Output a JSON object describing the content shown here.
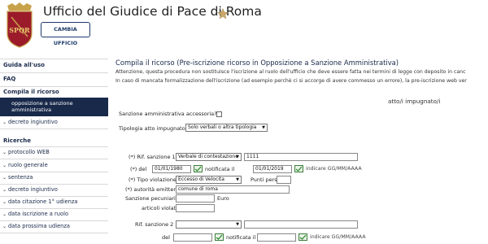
{
  "header": {
    "title": "Ufficio del Giudice di Pace di Roma",
    "logo_text": "SPQR",
    "change_office_label": "CAMBIA UFFICIO"
  },
  "sidebar": {
    "guida": "Guida all'uso",
    "faq": "FAQ",
    "compila": "Compila il ricorso",
    "active_item": "opposizione a sanzione amministrativa",
    "decreto": "decreto ingiuntivo",
    "ricerche": "Ricerche",
    "search_items": [
      "protocollo WEB",
      "ruolo generale",
      "sentenza",
      "decreto ingiuntivo",
      "data citazione 1° udienza",
      "data iscrizione a ruolo",
      "data prossima udienza"
    ]
  },
  "main": {
    "title": "Compila il ricorso (Pre-iscrizione ricorso in Opposizione a Sanzione Amministrativa)",
    "notice_line1": "Attenzione, questa procedura non sostituisce l'iscrizione al ruolo dell'ufficio che deve essere fatta nei termini di legge con deposito in canc",
    "notice_line2": "In caso di mancata formalizzazione dell'iscrizione (ad esempio perchè ci si accorge di avere commesso un errore), la pre-iscrizione web ver",
    "atto_impugnato": "atto/i impugnato/i",
    "sanzione_accessoria_label": "Sanzione amministrativa accessoria?",
    "tipologia_label": "Tipologia atto impugnato",
    "tipologia_value": "Solo verbali o altra tipologia",
    "rif_sanzione_1_label": "(*) Rif. sanzione 1",
    "rif_sanzione_1_type": "Verbale di contestazione",
    "rif_sanzione_1_number": "1111",
    "del_label_1": "(*) del",
    "del_value_1": "01/01/1980",
    "notificata_label_1": "notificata il",
    "notificata_value_1": "01/01/2019",
    "indicare_1": "indicare GG/MM/AAAA",
    "tipo_violazione_label": "(*) Tipo violazione",
    "tipo_violazione_value": "Eccesso di Velocita",
    "punti_persi_label": "Punti persi",
    "autorita_label": "(*) autorità emittente",
    "autorita_value": "comune di roma",
    "sanzione_pecuniaria_label": "Sanzione pecuniaria",
    "euro_label": "Euro",
    "articoli_label": "articoli violati",
    "rif_sanzione_2_label": "Rif. sanzione 2",
    "del_label_2": "del",
    "notificata_label_2": "notificata il",
    "indicare_2": "indicare GG/MM/AAAA"
  },
  "colors": {
    "navy": "#18294a",
    "logo_red": "#9b1b2a",
    "gold": "#c8a24a"
  }
}
